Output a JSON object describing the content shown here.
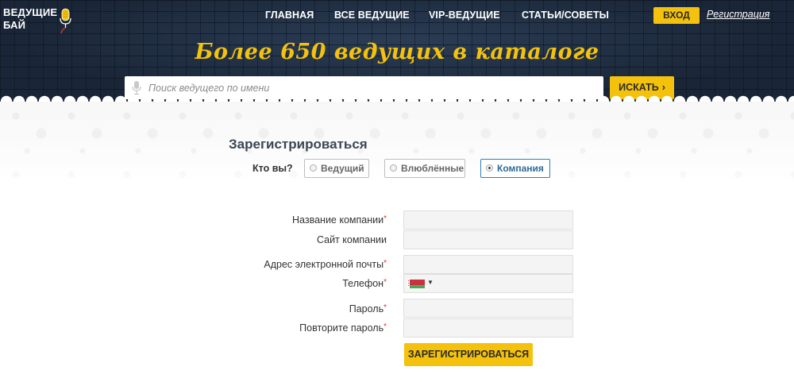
{
  "header": {
    "logo": {
      "line1": "ВЕДУЩИЕ",
      "line2": "БАЙ"
    },
    "nav": [
      {
        "label": "ГЛАВНАЯ"
      },
      {
        "label": "ВСЕ ВЕДУЩИЕ"
      },
      {
        "label": "VIP-ВЕДУЩИЕ"
      },
      {
        "label": "СТАТЬИ/СОВЕТЫ"
      }
    ],
    "login_label": "ВХОД",
    "register_label": "Регистрация",
    "tagline": "Более 650 ведущих в каталоге",
    "search": {
      "placeholder": "Поиск ведущего по имени",
      "value": "",
      "button_label": "ИСКАТЬ",
      "button_icon": "chevron-right-icon"
    }
  },
  "form": {
    "title": "Зарегистрироваться",
    "who_label": "Кто вы?",
    "options": [
      {
        "label": "Ведущий",
        "selected": false
      },
      {
        "label": "Влюблённые",
        "selected": false
      },
      {
        "label": "Компания",
        "selected": true
      }
    ],
    "fields": {
      "company_name": {
        "label": "Название компании",
        "required": "*",
        "value": ""
      },
      "company_site": {
        "label": "Сайт компании",
        "value": ""
      },
      "email": {
        "label": "Адрес электронной почты",
        "required": "*",
        "value": ""
      },
      "phone": {
        "label": "Телефон",
        "required": "*",
        "value": "",
        "country_flag": "belarus-flag-icon",
        "caret": "▼"
      },
      "password": {
        "label": "Пароль",
        "required": "*",
        "value": ""
      },
      "password_repeat": {
        "label": "Повторите пароль",
        "required": "*",
        "value": ""
      }
    },
    "submit_label": "ЗАРЕГИСТРИРОВАТЬСЯ"
  },
  "colors": {
    "accent": "#f4c20d",
    "header_bg": "#1d2b3d",
    "required": "#d0342c",
    "active_option": "#2d7fb8"
  }
}
